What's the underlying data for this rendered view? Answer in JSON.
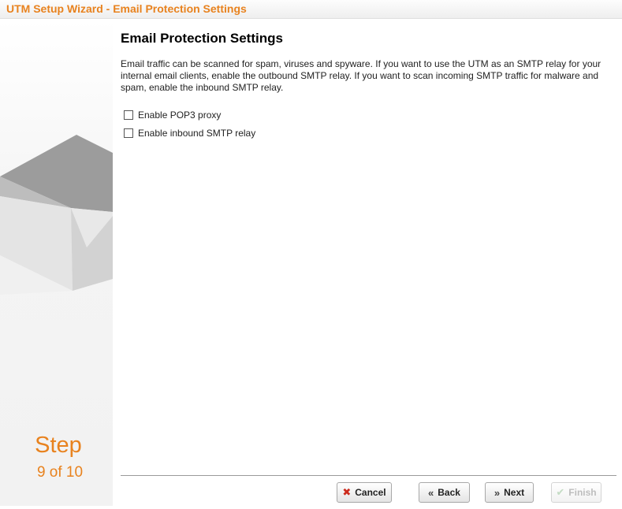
{
  "window": {
    "title": "UTM Setup Wizard - Email Protection Settings"
  },
  "sidebar": {
    "step_word": "Step",
    "step_count": "9 of 10"
  },
  "main": {
    "heading": "Email Protection Settings",
    "description": "Email traffic can be scanned for spam, viruses and spyware. If you want to use the UTM as an SMTP relay for your internal email clients, enable the outbound SMTP relay. If you want to scan incoming SMTP traffic for malware and spam, enable the inbound SMTP relay.",
    "options": [
      {
        "label": "Enable POP3 proxy",
        "checked": false
      },
      {
        "label": "Enable inbound SMTP relay",
        "checked": false
      }
    ]
  },
  "buttons": {
    "cancel": {
      "label": "Cancel",
      "icon": "close-icon",
      "color": "#cc2a1c"
    },
    "back": {
      "label": "Back",
      "icon": "double-chevron-left-icon"
    },
    "next": {
      "label": "Next",
      "icon": "double-chevron-right-icon"
    },
    "finish": {
      "label": "Finish",
      "icon": "checkmark-icon",
      "disabled": true
    }
  },
  "colors": {
    "accent": "#e8821e"
  }
}
